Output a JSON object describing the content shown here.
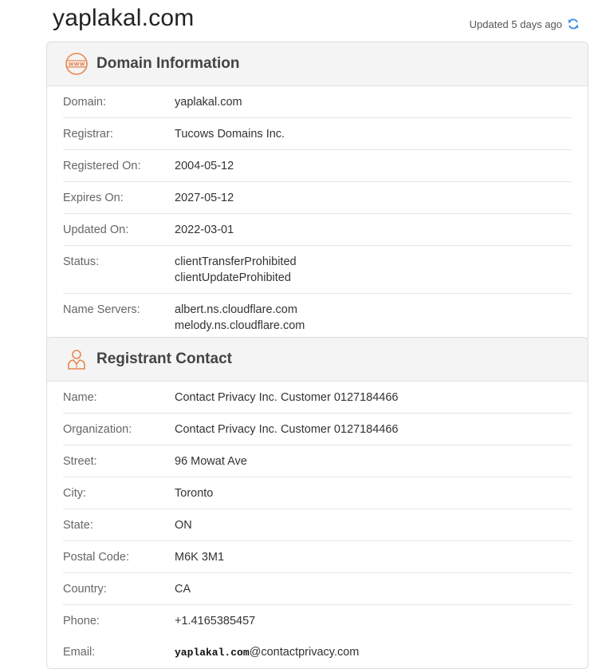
{
  "site": {
    "title": "yaplakal.com",
    "updated": "Updated 5 days ago"
  },
  "colors": {
    "accent_orange": "#e8874f",
    "refresh_blue": "#3a8ee6"
  },
  "domain_info": {
    "title": "Domain Information",
    "icon": "www-icon",
    "rows": [
      {
        "label": "Domain:",
        "values": [
          "yaplakal.com"
        ]
      },
      {
        "label": "Registrar:",
        "values": [
          "Tucows Domains Inc."
        ]
      },
      {
        "label": "Registered On:",
        "values": [
          "2004-05-12"
        ]
      },
      {
        "label": "Expires On:",
        "values": [
          "2027-05-12"
        ]
      },
      {
        "label": "Updated On:",
        "values": [
          "2022-03-01"
        ]
      },
      {
        "label": "Status:",
        "values": [
          "clientTransferProhibited",
          "clientUpdateProhibited"
        ]
      },
      {
        "label": "Name Servers:",
        "values": [
          "albert.ns.cloudflare.com",
          "melody.ns.cloudflare.com"
        ]
      }
    ]
  },
  "registrant": {
    "title": "Registrant Contact",
    "icon": "person-icon",
    "rows": [
      {
        "label": "Name:",
        "values": [
          "Contact Privacy Inc. Customer 0127184466"
        ]
      },
      {
        "label": "Organization:",
        "values": [
          "Contact Privacy Inc. Customer 0127184466"
        ]
      },
      {
        "label": "Street:",
        "values": [
          "96 Mowat Ave"
        ]
      },
      {
        "label": "City:",
        "values": [
          "Toronto"
        ]
      },
      {
        "label": "State:",
        "values": [
          "ON"
        ]
      },
      {
        "label": "Postal Code:",
        "values": [
          "M6K 3M1"
        ]
      },
      {
        "label": "Country:",
        "values": [
          "CA"
        ]
      },
      {
        "label": "Phone:",
        "values": [
          "+1.4165385457"
        ]
      }
    ],
    "email": {
      "label": "Email:",
      "user": "yaplakal.com",
      "domain": "@contactprivacy.com"
    }
  }
}
